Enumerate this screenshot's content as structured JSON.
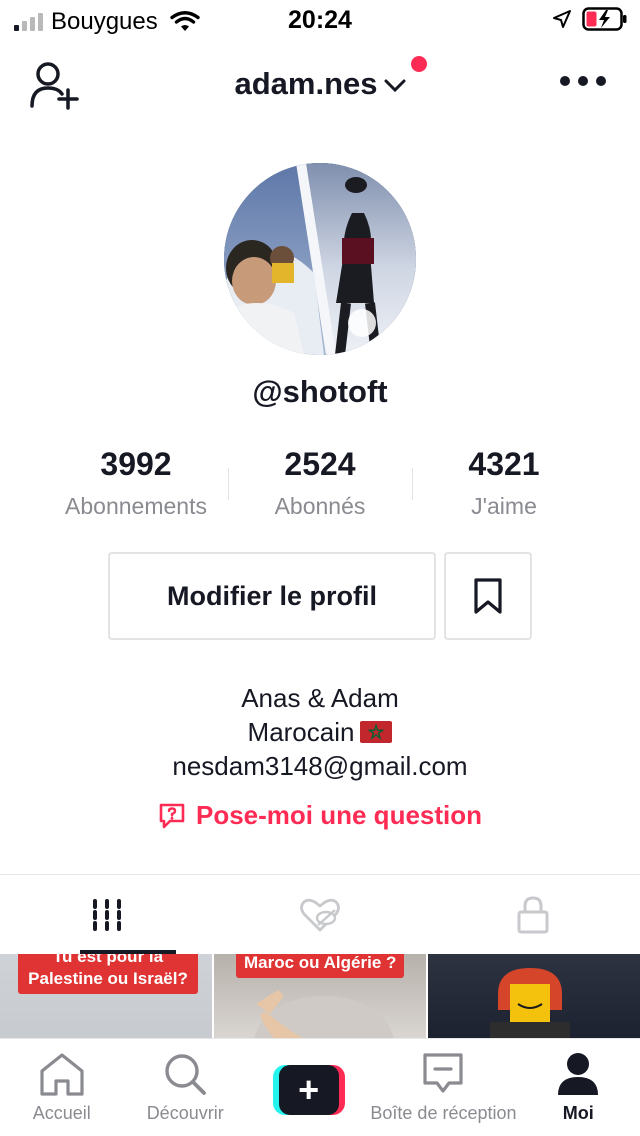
{
  "status_bar": {
    "carrier": "Bouygues",
    "time": "20:24"
  },
  "header": {
    "username": "adam.nes",
    "icons": [
      "add-friend-icon",
      "chevron-down-icon",
      "more-icon"
    ]
  },
  "profile": {
    "handle": "@shotoft",
    "stats": [
      {
        "value": "3992",
        "label": "Abonnements"
      },
      {
        "value": "2524",
        "label": "Abonnés"
      },
      {
        "value": "4321",
        "label": "J'aime"
      }
    ],
    "edit_button": "Modifier le profil",
    "bio_lines": [
      "Anas & Adam",
      "Marocain",
      "nesdam3148@gmail.com"
    ],
    "question_link": "Pose-moi une question"
  },
  "tabs": [
    "videos-grid-icon",
    "liked-icon",
    "private-lock-icon"
  ],
  "videos": [
    {
      "caption": "Tu est pour la Palestine ou Israël?"
    },
    {
      "caption": "Maroc ou Algérie ?"
    },
    {
      "caption": ""
    }
  ],
  "bottom_nav": [
    {
      "label": "Accueil",
      "icon": "home-icon"
    },
    {
      "label": "Découvrir",
      "icon": "search-icon"
    },
    {
      "label": "",
      "icon": "create-icon"
    },
    {
      "label": "Boîte de réception",
      "icon": "inbox-icon"
    },
    {
      "label": "Moi",
      "icon": "profile-icon",
      "active": true
    }
  ],
  "colors": {
    "accent": "#fe2c55",
    "cyan": "#25f4ee",
    "text": "#161823",
    "muted": "#8a8b91"
  }
}
